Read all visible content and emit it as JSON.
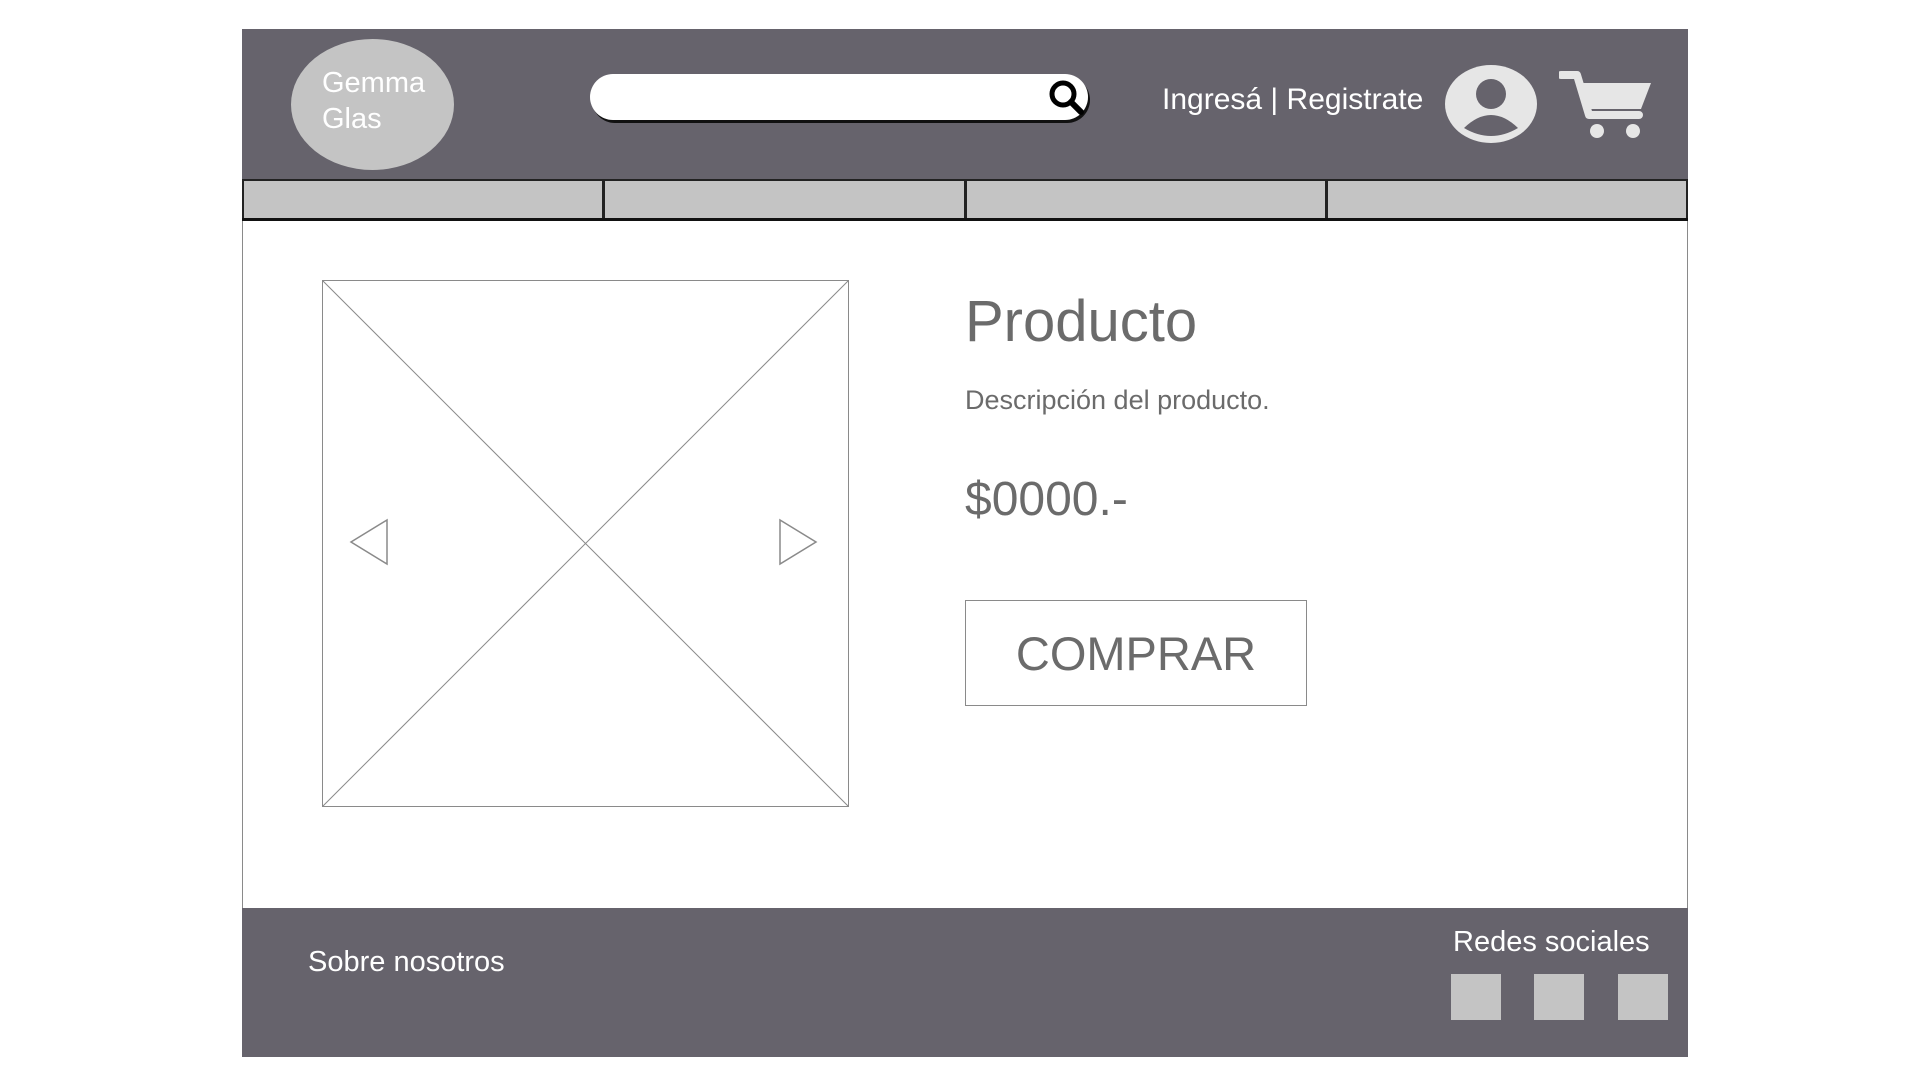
{
  "header": {
    "logo": {
      "line1": "Gemma",
      "line2": "Glas"
    },
    "search": {
      "value": "",
      "placeholder": ""
    },
    "auth": {
      "login": "Ingresá",
      "separator": " | ",
      "register": "Registrate"
    },
    "icons": {
      "search": "search-icon",
      "user": "user-circle-icon",
      "cart": "shopping-cart-icon"
    }
  },
  "nav": {
    "items": [
      {
        "label": ""
      },
      {
        "label": ""
      },
      {
        "label": ""
      },
      {
        "label": ""
      }
    ]
  },
  "product": {
    "title": "Producto",
    "description": "Descripción del producto.",
    "price": "$0000.-",
    "buy_label": "COMPRAR",
    "gallery_icons": {
      "prev": "triangle-left-icon",
      "next": "triangle-right-icon"
    }
  },
  "footer": {
    "about": "Sobre nosotros",
    "social_title": "Redes sociales",
    "social_icons": [
      "social-icon-1",
      "social-icon-2",
      "social-icon-3"
    ]
  },
  "colors": {
    "header_bg": "#66636c",
    "placeholder_gray": "#c4c4c4",
    "text_gray": "#6b6b6b",
    "white": "#ffffff"
  }
}
